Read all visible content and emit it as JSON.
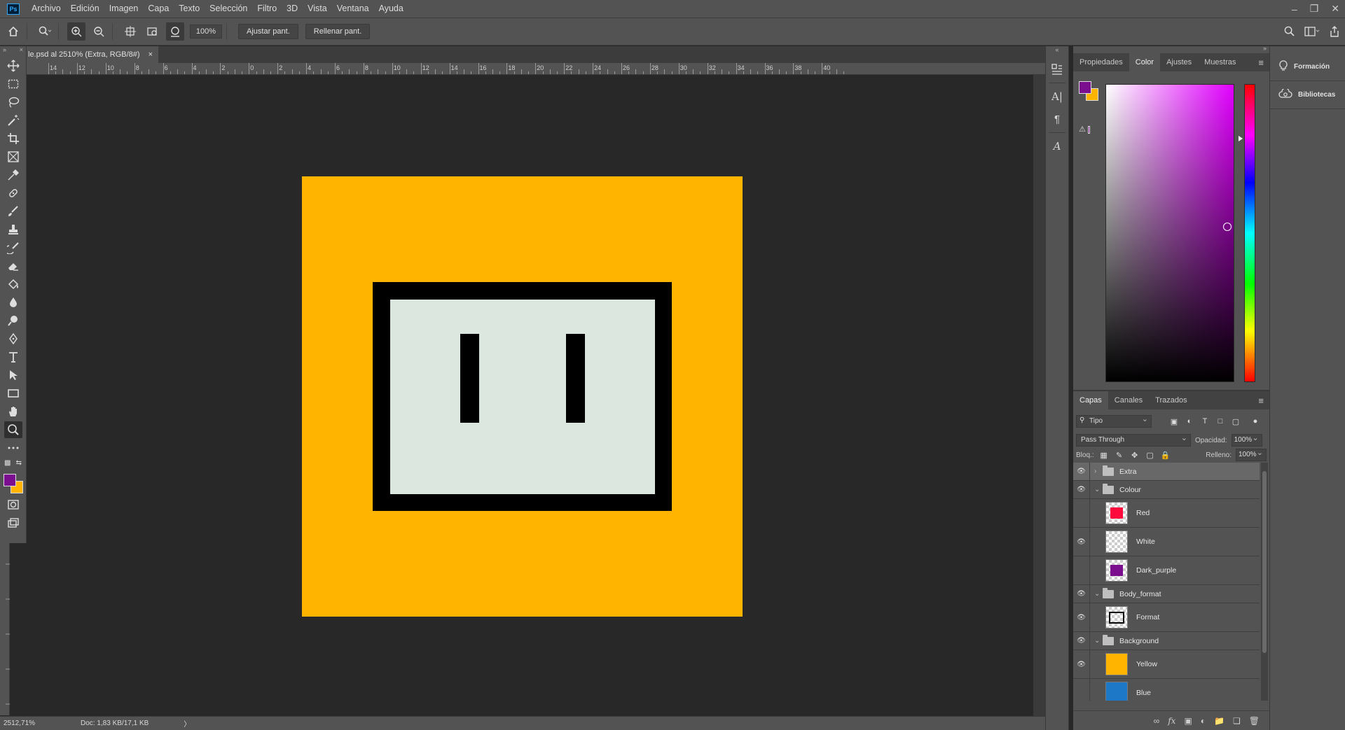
{
  "menubar": {
    "logo": "Ps",
    "items": [
      "Archivo",
      "Edición",
      "Imagen",
      "Capa",
      "Texto",
      "Selección",
      "Filtro",
      "3D",
      "Vista",
      "Ventana",
      "Ayuda"
    ],
    "window_controls": [
      "minimize-icon",
      "restore-icon",
      "close-icon"
    ]
  },
  "options": {
    "zoom_value": "100%",
    "fit_screen_label": "Ajustar pant.",
    "fill_screen_label": "Rellenar pant."
  },
  "document": {
    "tab_title": "le.psd al 2510% (Extra, RGB/8#)",
    "close_glyph": "×",
    "ruler_labels": [
      "14",
      "12",
      "10",
      "8",
      "6",
      "4",
      "2",
      "0",
      "2",
      "4",
      "6",
      "8",
      "10",
      "12",
      "14",
      "16",
      "18",
      "20",
      "22",
      "24",
      "26",
      "28",
      "30",
      "32",
      "34",
      "36",
      "38",
      "40"
    ],
    "artwork_colors": {
      "background": "#FFB400",
      "frame": "#000000",
      "screen": "#DCE7E0",
      "eyes": "#000000"
    }
  },
  "status": {
    "zoom": "2512,71%",
    "doc_info": "Doc: 1,83 KB/17,1 KB",
    "chevron": "〉"
  },
  "tools": [
    "move-icon",
    "marquee-icon",
    "lasso-icon",
    "magic-wand-icon",
    "crop-icon",
    "frame-icon",
    "eyedropper-icon",
    "healing-brush-icon",
    "brush-icon",
    "clone-stamp-icon",
    "history-brush-icon",
    "eraser-icon",
    "paint-bucket-icon",
    "blur-icon",
    "dodge-icon",
    "pen-icon",
    "type-icon",
    "path-selection-icon",
    "rectangle-icon",
    "hand-icon",
    "zoom-icon",
    "more-tools-icon"
  ],
  "colors": {
    "foreground": "#7B0E8E",
    "background": "#FFB400",
    "accent": "#31A8FF"
  },
  "color_panel": {
    "tabs": [
      "Propiedades",
      "Color",
      "Ajustes",
      "Muestras"
    ],
    "active_tab": "Color",
    "hue_color": "#E100FF"
  },
  "layers_panel": {
    "tabs": [
      "Capas",
      "Canales",
      "Trazados"
    ],
    "active_tab": "Capas",
    "filter_label": "Tipo",
    "blend_mode": "Pass Through",
    "opacity_label": "Opacidad:",
    "opacity_value": "100%",
    "lock_label": "Bloq.:",
    "fill_label": "Relleno:",
    "fill_value": "100%",
    "layers": [
      {
        "name": "Extra",
        "kind": "group",
        "visible": true,
        "expanded": false,
        "selected": true
      },
      {
        "name": "Colour",
        "kind": "group",
        "visible": true,
        "expanded": true
      },
      {
        "name": "Red",
        "kind": "layer",
        "visible": false,
        "thumb": "#FF0A3C",
        "solid": false
      },
      {
        "name": "White",
        "kind": "layer",
        "visible": true,
        "thumb": "",
        "solid": false
      },
      {
        "name": "Dark_purple",
        "kind": "layer",
        "visible": false,
        "thumb": "#7B0E8E",
        "solid": false
      },
      {
        "name": "Body_format",
        "kind": "group",
        "visible": true,
        "expanded": true
      },
      {
        "name": "Format",
        "kind": "layer",
        "visible": true,
        "thumb": "frame",
        "solid": false
      },
      {
        "name": "Background",
        "kind": "group",
        "visible": true,
        "expanded": true
      },
      {
        "name": "Yellow",
        "kind": "layer",
        "visible": true,
        "thumb": "#FFB400",
        "solid": true
      },
      {
        "name": "Blue",
        "kind": "layer",
        "visible": false,
        "thumb": "#1E78C8",
        "solid": true
      }
    ]
  },
  "side_panel": {
    "items": [
      {
        "label": "Formación",
        "icon": "lightbulb-icon"
      },
      {
        "label": "Bibliotecas",
        "icon": "libraries-icon"
      }
    ]
  }
}
